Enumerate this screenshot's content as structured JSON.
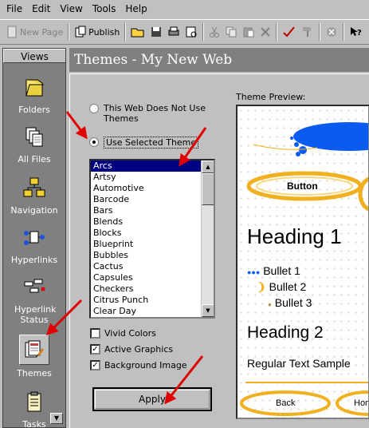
{
  "menu": [
    "File",
    "Edit",
    "View",
    "Tools",
    "Help"
  ],
  "toolbar": {
    "new_page": "New Page",
    "publish": "Publish"
  },
  "views": {
    "header": "Views",
    "items": [
      {
        "label": "Folders",
        "icon": "folder-icon"
      },
      {
        "label": "All Files",
        "icon": "all-files-icon"
      },
      {
        "label": "Navigation",
        "icon": "navigation-icon"
      },
      {
        "label": "Hyperlinks",
        "icon": "hyperlinks-icon"
      },
      {
        "label": "Hyperlink Status",
        "icon": "hyperlink-status-icon"
      },
      {
        "label": "Themes",
        "icon": "themes-icon",
        "active": true
      },
      {
        "label": "Tasks",
        "icon": "tasks-icon"
      }
    ]
  },
  "page_title": "Themes - My New Web",
  "options": {
    "no_theme": "This Web Does Not Use Themes",
    "use_selected": "Use Selected Theme",
    "selected_option": "use_selected"
  },
  "themes": [
    "Arcs",
    "Artsy",
    "Automotive",
    "Barcode",
    "Bars",
    "Blends",
    "Blocks",
    "Blueprint",
    "Bubbles",
    "Cactus",
    "Capsules",
    "Checkers",
    "Citrus Punch",
    "Clear Day"
  ],
  "selected_theme": "Arcs",
  "checkboxes": [
    {
      "label": "Vivid Colors",
      "checked": false
    },
    {
      "label": "Active Graphics",
      "checked": true
    },
    {
      "label": "Background Image",
      "checked": true
    }
  ],
  "apply_label": "Apply",
  "preview": {
    "label": "Theme Preview:",
    "button": "Button",
    "heading1": "Heading 1",
    "bullets": [
      "Bullet 1",
      "Bullet 2",
      "Bullet 3"
    ],
    "heading2": "Heading 2",
    "regular": "Regular Text Sample",
    "nav": [
      "Back",
      "Home"
    ]
  },
  "colors": {
    "selection": "#000080",
    "annotation_arrow": "#e00000",
    "arc_blue": "#0a5cf0",
    "arc_gold": "#f0b020"
  }
}
